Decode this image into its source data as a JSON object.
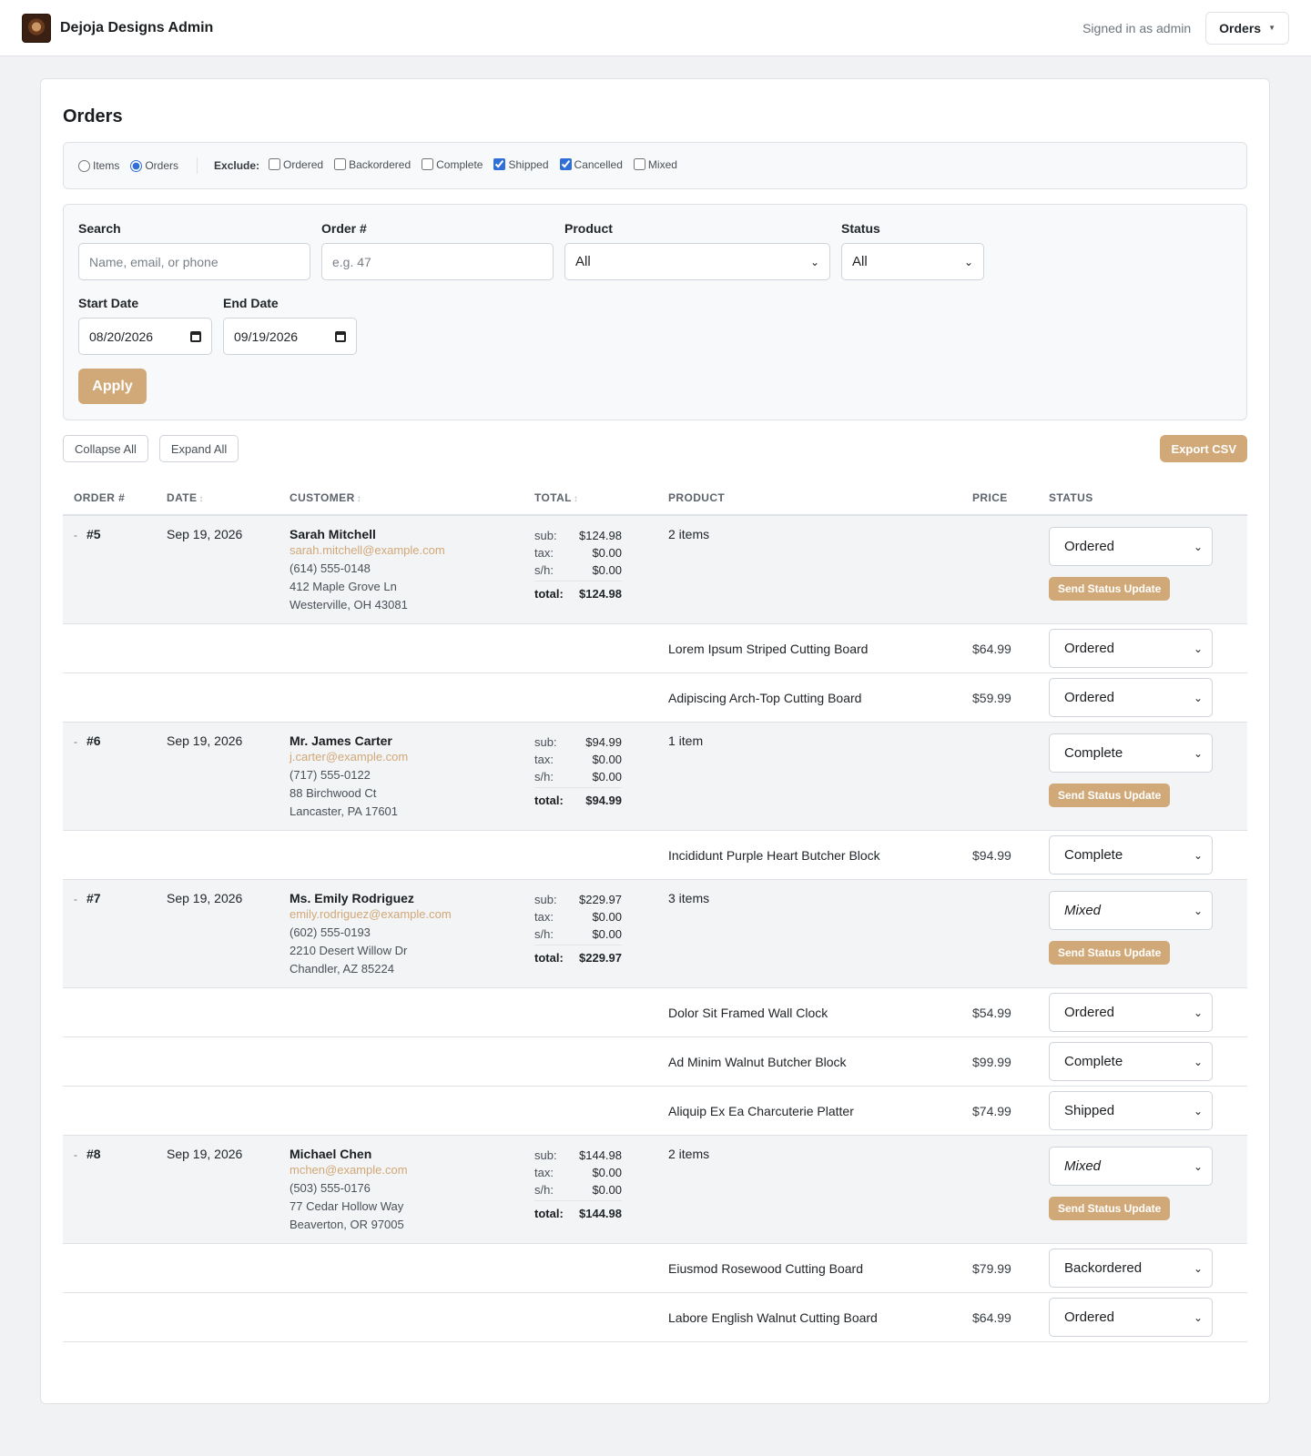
{
  "header": {
    "brand": "Dejoja Designs Admin",
    "signed_in": "Signed in as admin",
    "menu_label": "Orders"
  },
  "page": {
    "title": "Orders"
  },
  "filter_bar": {
    "view_items": "Items",
    "view_orders": "Orders",
    "view_selected": "Orders",
    "exclude_label": "Exclude:",
    "exclude": [
      {
        "label": "Ordered",
        "checked": false
      },
      {
        "label": "Backordered",
        "checked": false
      },
      {
        "label": "Complete",
        "checked": false
      },
      {
        "label": "Shipped",
        "checked": true
      },
      {
        "label": "Cancelled",
        "checked": true
      },
      {
        "label": "Mixed",
        "checked": false
      }
    ]
  },
  "search_panel": {
    "search_label": "Search",
    "search_placeholder": "Name, email, or phone",
    "order_label": "Order #",
    "order_placeholder": "e.g. 47",
    "product_label": "Product",
    "product_value": "All",
    "status_label": "Status",
    "status_value": "All",
    "start_label": "Start Date",
    "start_value": "08/20/2026",
    "end_label": "End Date",
    "end_value": "09/19/2026",
    "apply_label": "Apply"
  },
  "actions": {
    "collapse_all": "Collapse All",
    "expand_all": "Expand All",
    "export_csv": "Export CSV"
  },
  "table": {
    "headers": {
      "order": "ORDER #",
      "date": "DATE",
      "customer": "CUSTOMER",
      "total": "TOTAL",
      "product": "PRODUCT",
      "price": "PRICE",
      "status": "STATUS"
    },
    "sort_glyph": "↕",
    "labels": {
      "sub": "sub:",
      "tax": "tax:",
      "sh": "s/h:",
      "total": "total:",
      "send": "Send Status Update",
      "toggle": "-"
    },
    "orders": [
      {
        "number": "#5",
        "date": "Sep 19, 2026",
        "name": "Sarah Mitchell",
        "email": "sarah.mitchell@example.com",
        "phone": "(614) 555-0148",
        "address1": "412 Maple Grove Ln",
        "address2": "Westerville, OH 43081",
        "sub": "$124.98",
        "tax": "$0.00",
        "sh": "$0.00",
        "total": "$124.98",
        "items_count": "2 items",
        "status": "Ordered",
        "items": [
          {
            "product": "Lorem Ipsum Striped Cutting Board",
            "price": "$64.99",
            "status": "Ordered"
          },
          {
            "product": "Adipiscing Arch-Top Cutting Board",
            "price": "$59.99",
            "status": "Ordered"
          }
        ]
      },
      {
        "number": "#6",
        "date": "Sep 19, 2026",
        "name": "Mr. James Carter",
        "email": "j.carter@example.com",
        "phone": "(717) 555-0122",
        "address1": "88 Birchwood Ct",
        "address2": "Lancaster, PA 17601",
        "sub": "$94.99",
        "tax": "$0.00",
        "sh": "$0.00",
        "total": "$94.99",
        "items_count": "1 item",
        "status": "Complete",
        "items": [
          {
            "product": "Incididunt Purple Heart Butcher Block",
            "price": "$94.99",
            "status": "Complete"
          }
        ]
      },
      {
        "number": "#7",
        "date": "Sep 19, 2026",
        "name": "Ms. Emily Rodriguez",
        "email": "emily.rodriguez@example.com",
        "phone": "(602) 555-0193",
        "address1": "2210 Desert Willow Dr",
        "address2": "Chandler, AZ 85224",
        "sub": "$229.97",
        "tax": "$0.00",
        "sh": "$0.00",
        "total": "$229.97",
        "items_count": "3 items",
        "status": "Mixed",
        "items": [
          {
            "product": "Dolor Sit Framed Wall Clock",
            "price": "$54.99",
            "status": "Ordered"
          },
          {
            "product": "Ad Minim Walnut Butcher Block",
            "price": "$99.99",
            "status": "Complete"
          },
          {
            "product": "Aliquip Ex Ea Charcuterie Platter",
            "price": "$74.99",
            "status": "Shipped"
          }
        ]
      },
      {
        "number": "#8",
        "date": "Sep 19, 2026",
        "name": "Michael Chen",
        "email": "mchen@example.com",
        "phone": "(503) 555-0176",
        "address1": "77 Cedar Hollow Way",
        "address2": "Beaverton, OR 97005",
        "sub": "$144.98",
        "tax": "$0.00",
        "sh": "$0.00",
        "total": "$144.98",
        "items_count": "2 items",
        "status": "Mixed",
        "items": [
          {
            "product": "Eiusmod Rosewood Cutting Board",
            "price": "$79.99",
            "status": "Backordered"
          },
          {
            "product": "Labore English Walnut Cutting Board",
            "price": "$64.99",
            "status": "Ordered"
          }
        ]
      }
    ]
  }
}
